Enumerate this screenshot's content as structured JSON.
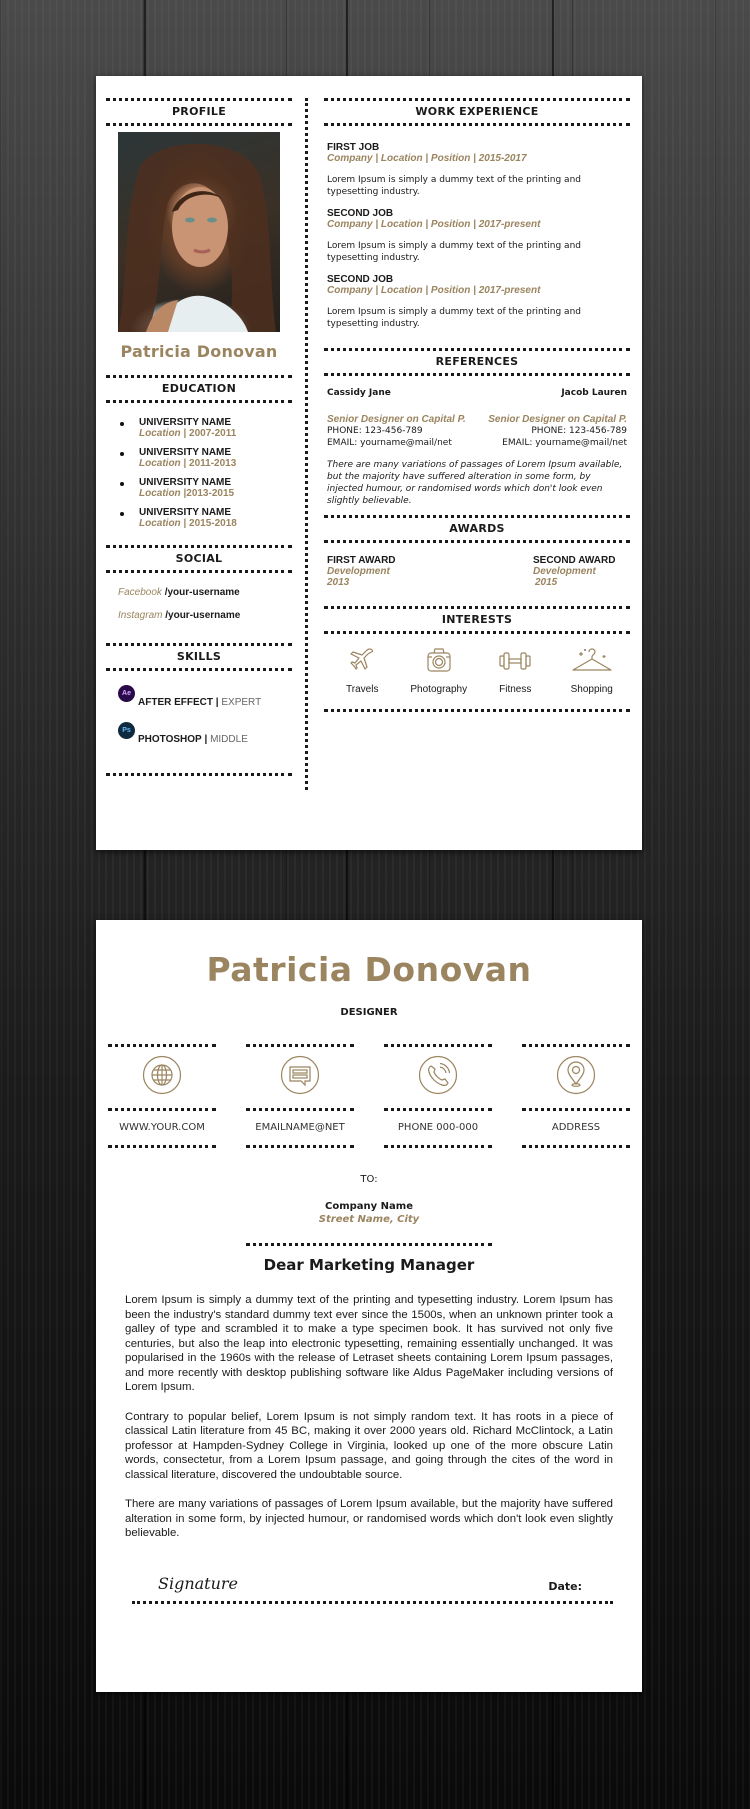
{
  "colors": {
    "accent": "#9b8560",
    "text": "#1a1a1a",
    "background": "#1b1b1b"
  },
  "resume": {
    "profile": {
      "heading": "PROFILE",
      "photo_alt": "Portrait of woman with long curly brown hair",
      "name": "Patricia Donovan"
    },
    "work_experience": {
      "heading": "WORK EXPERIENCE",
      "jobs": [
        {
          "title": "FIRST JOB",
          "meta": "Company | Location | Position | 2015-2017",
          "desc": "Lorem Ipsum is simply a dummy text of the printing and typesetting industry."
        },
        {
          "title": "SECOND JOB",
          "meta": "Company | Location | Position | 2017-present",
          "desc": "Lorem Ipsum is simply a dummy text of the printing and typesetting industry."
        },
        {
          "title": "SECOND JOB",
          "meta": "Company | Location | Position | 2017-present",
          "desc": "Lorem Ipsum is simply a dummy text of the printing and typesetting industry."
        }
      ]
    },
    "education": {
      "heading": "EDUCATION",
      "items": [
        {
          "name": "UNIVERSITY NAME",
          "location": "Location",
          "years": "| 2007-2011"
        },
        {
          "name": "UNIVERSITY NAME",
          "location": "Location",
          "years": "| 2011-2013"
        },
        {
          "name": "UNIVERSITY NAME",
          "location": "Location",
          "years": "|2013-2015"
        },
        {
          "name": "UNIVERSITY NAME",
          "location": "Location",
          "years": "| 2015-2018"
        }
      ]
    },
    "references": {
      "heading": "REFERENCES",
      "people": [
        {
          "name": "Cassidy Jane",
          "position": "Senior Designer on Capital P.",
          "phone": "PHONE: 123-456-789",
          "email": "EMAIL: yourname@mail/net"
        },
        {
          "name": "Jacob Lauren",
          "position": "Senior Designer on Capital P.",
          "phone": "PHONE: 123-456-789",
          "email": "EMAIL: yourname@mail/net"
        }
      ],
      "note": "There are many variations of passages of Lorem Ipsum available, but the majority have suffered alteration in some form, by injected humour, or randomised words which don't look even slightly believable."
    },
    "social": {
      "heading": "SOCIAL",
      "items": [
        {
          "network": "Facebook",
          "handle": "/your-username"
        },
        {
          "network": "Instagram",
          "handle": "/your-username"
        }
      ]
    },
    "awards": {
      "heading": "AWARDS",
      "items": [
        {
          "title": "FIRST AWARD",
          "field": "Development",
          "year": "2013"
        },
        {
          "title": "SECOND AWARD",
          "field": "Development",
          "year": "2015"
        }
      ]
    },
    "skills": {
      "heading": "SKILLS",
      "items": [
        {
          "icon": "Ae",
          "name": "AFTER EFFECT",
          "separator": " | ",
          "level": "EXPERT"
        },
        {
          "icon": "Ps",
          "name": "PHOTOSHOP",
          "separator": " | ",
          "level": "MIDDLE"
        }
      ]
    },
    "interests": {
      "heading": "INTERESTS",
      "items": [
        {
          "icon": "airplane-icon",
          "label": "Travels"
        },
        {
          "icon": "camera-icon",
          "label": "Photography"
        },
        {
          "icon": "dumbbell-icon",
          "label": "Fitness"
        },
        {
          "icon": "hanger-icon",
          "label": "Shopping"
        }
      ]
    }
  },
  "cover_letter": {
    "name": "Patricia Donovan",
    "role": "DESIGNER",
    "contacts": [
      {
        "icon": "globe-icon",
        "text": "WWW.YOUR.COM"
      },
      {
        "icon": "chat-icon",
        "text": "EMAILNAME@NET"
      },
      {
        "icon": "phone-icon",
        "text": "PHONE 000-000"
      },
      {
        "icon": "location-pin-icon",
        "text": "ADDRESS"
      }
    ],
    "to_label": "TO:",
    "company": "Company Name",
    "street": "Street Name, City",
    "salutation": "Dear Marketing Manager",
    "paragraphs": [
      "Lorem Ipsum is simply a dummy text of the printing and typesetting industry. Lorem Ipsum has been the industry's standard dummy text ever since the 1500s, when an unknown printer took a galley of type and scrambled it to make a type specimen book. It has survived not only five centuries, but also the leap into electronic typesetting, remaining essentially unchanged. It was popularised in the 1960s with the release of Letraset sheets containing Lorem Ipsum passages, and more recently with desktop publishing software like Aldus PageMaker including versions of Lorem Ipsum.",
      "Contrary to popular belief, Lorem Ipsum is not simply random text. It has roots in a piece of classical Latin literature from 45 BC, making it over 2000 years old. Richard McClintock, a Latin professor at Hampden-Sydney College in Virginia, looked up one of the more obscure Latin words, consectetur, from a Lorem Ipsum passage, and going through the cites of the word in classical literature, discovered the undoubtable source.",
      "There are many variations of passages of Lorem Ipsum available, but the majority have suffered alteration in some form, by injected humour, or randomised words which don't look even slightly believable."
    ],
    "signature_label": "Signature",
    "date_label": "Date:"
  }
}
